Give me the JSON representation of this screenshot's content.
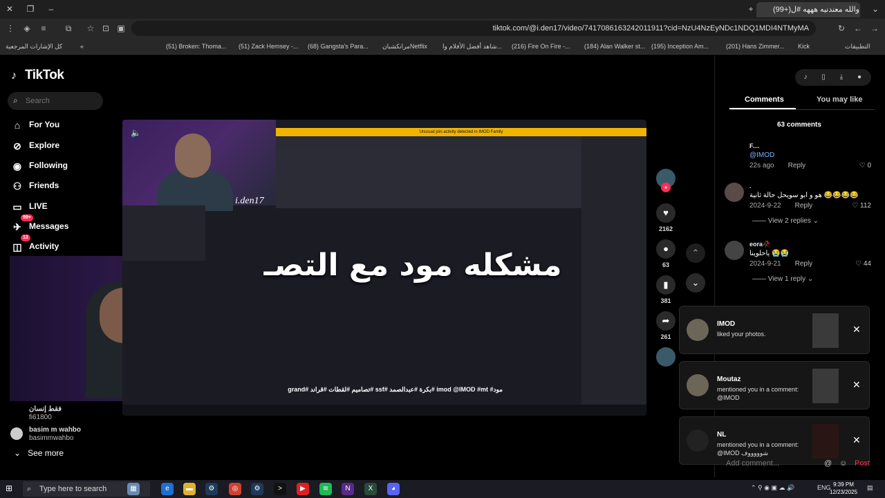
{
  "browser": {
    "tab_title": "(99+)والله معندنيه هههه #ل",
    "url": "tiktok.com/@i.den17/video/7417086163242011911?cid=NzU4NzEyNDc1NDQ1MDI4NTMyMA",
    "bookmarks": [
      "كل الإشارات المرجعية",
      "(51) Broken: Thoma...",
      "(51) Zack Hemsey -...",
      "(68) Gangsta's Para...",
      "مرانكشبانNetflix",
      "شاهد أفضل الأفلام وا...",
      "(216) Fire On Fire -...",
      "(184) Alan Walker st...",
      "(195) Inception Am...",
      "(201) Hans Zimmer...",
      "Kick",
      "التطبيقات"
    ]
  },
  "sidebar": {
    "logo": "TikTok",
    "search_placeholder": "Search",
    "nav": [
      {
        "label": "For You",
        "icon": "home-icon"
      },
      {
        "label": "Explore",
        "icon": "compass-icon"
      },
      {
        "label": "Following",
        "icon": "following-icon"
      },
      {
        "label": "Friends",
        "icon": "friends-icon"
      },
      {
        "label": "LIVE",
        "icon": "live-icon"
      },
      {
        "label": "Messages",
        "icon": "messages-icon",
        "badge": "99+"
      },
      {
        "label": "Activity",
        "icon": "activity-icon",
        "badge": "13"
      }
    ],
    "accounts": [
      {
        "name": "فقط إنسان",
        "handle": "fi61800"
      },
      {
        "name": "basim m wahbo",
        "handle": "basimmwahbo"
      }
    ],
    "see_more": "See more"
  },
  "video": {
    "tag": "i.den17",
    "alert": "Unusual join activity detected in IMOD Family",
    "overlay_text": "مشكله مود مع التصـ",
    "caption": "مود# imod @IMOD #mt #بكرة #عبدالصمد #ssf #تصاميم #لقطات #قراند #grand"
  },
  "actions": {
    "likes": "2162",
    "comments": "63",
    "saves": "381",
    "shares": "261"
  },
  "panel": {
    "tab_comments": "Comments",
    "tab_you_may_like": "You may like",
    "comment_count": "63 comments",
    "comments": [
      {
        "name": "F....",
        "text": "@IMOD",
        "date": "22s ago",
        "reply": "Reply",
        "likes": "0",
        "replies": ""
      },
      {
        "name": ".",
        "text": "هو و ابو سويحل حالة ثانية 😂😂😂😂",
        "date": "2024-9-22",
        "reply": "Reply",
        "likes": "112",
        "replies": "View 2 replies"
      },
      {
        "name": "eora🥀",
        "text": "ياحلوينا 😭😭",
        "date": "2024-9-21",
        "reply": "Reply",
        "likes": "44",
        "replies": "View 1 reply"
      }
    ],
    "add_comment_placeholder": "Add comment...",
    "post": "Post"
  },
  "notifications": [
    {
      "name": "IMOD",
      "text": "liked your photos."
    },
    {
      "name": "Moutaz",
      "text": "mentioned you in a comment: @IMOD"
    },
    {
      "name": "NL",
      "text": "mentioned you in a comment: @IMOD شوووووف"
    }
  ],
  "taskbar": {
    "search_placeholder": "Type here to search",
    "lang": "ENG",
    "time": "9:39 PM",
    "date": "12/23/2025"
  },
  "colors": {
    "accent": "#fe2c55",
    "alert": "#f0b400"
  }
}
